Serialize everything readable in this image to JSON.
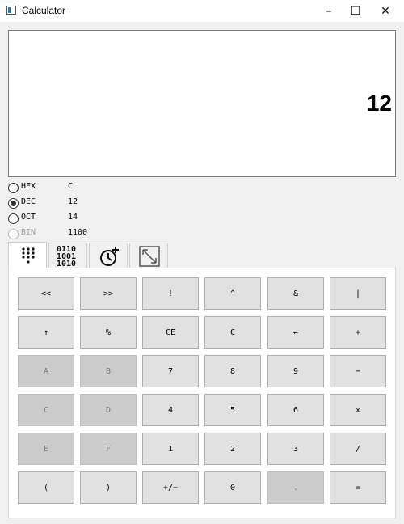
{
  "window": {
    "title": "Calculator",
    "minimize": "–",
    "maximize": "☐",
    "close": "✕"
  },
  "display": {
    "value": "12"
  },
  "bases": [
    {
      "label": "HEX",
      "value": "C",
      "checked": false,
      "disabled": false
    },
    {
      "label": "DEC",
      "value": "12",
      "checked": true,
      "disabled": false
    },
    {
      "label": "OCT",
      "value": "14",
      "checked": false,
      "disabled": false
    },
    {
      "label": "BIN",
      "value": "1100",
      "checked": false,
      "disabled": true
    }
  ],
  "tabs": [
    {
      "icon": "keypad-dots-icon",
      "active": true
    },
    {
      "icon": "binary-icon",
      "text": [
        "0110",
        "1001",
        "1010"
      ],
      "active": false
    },
    {
      "icon": "history-icon",
      "active": false
    },
    {
      "icon": "resize-icon",
      "active": false
    }
  ],
  "keys": [
    [
      "<<",
      ">>",
      "!",
      "^",
      "&",
      "|"
    ],
    [
      "↑",
      "%",
      "CE",
      "C",
      "←",
      "+"
    ],
    [
      "A",
      "B",
      "7",
      "8",
      "9",
      "−"
    ],
    [
      "C",
      "D",
      "4",
      "5",
      "6",
      "x"
    ],
    [
      "E",
      "F",
      "1",
      "2",
      "3",
      "/"
    ],
    [
      "(",
      ")",
      "+/−",
      "0",
      ".",
      "="
    ]
  ],
  "disabled_keys": [
    "A",
    "B",
    "C_hex",
    "D",
    "E",
    "F",
    "."
  ]
}
